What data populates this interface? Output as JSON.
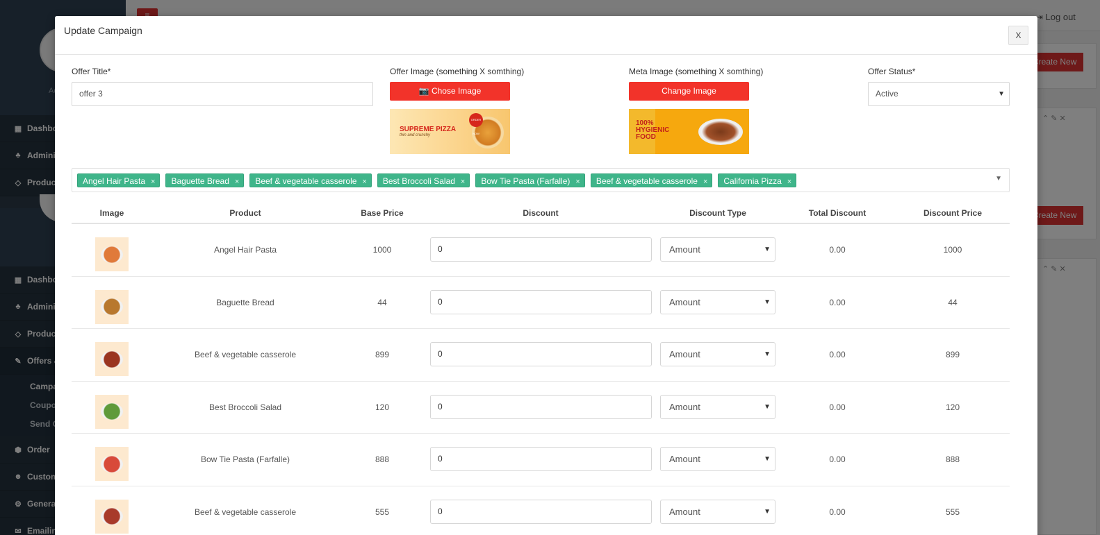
{
  "app": {
    "logout": "Log out",
    "create_new": "Create New",
    "sidebar": {
      "avatar_caption": "Ad",
      "menu_top": [
        {
          "label": "Dashbo",
          "icon": "dashboard-icon"
        },
        {
          "label": "Adminis",
          "icon": "sitemap-icon"
        },
        {
          "label": "Product",
          "icon": "diamond-icon"
        }
      ],
      "menu_bottom": [
        {
          "label": "Dashbo",
          "icon": "dashboard-icon"
        },
        {
          "label": "Adminis",
          "icon": "sitemap-icon"
        },
        {
          "label": "Product",
          "icon": "diamond-icon"
        },
        {
          "label": "Offers &",
          "icon": "fire-icon"
        }
      ],
      "offers_submenu": [
        "Campa",
        "Coupo",
        "Send C"
      ],
      "menu_after": [
        {
          "label": "Order",
          "icon": "cube-icon"
        },
        {
          "label": "Custom",
          "icon": "users-icon"
        },
        {
          "label": "General",
          "icon": "gear-icon"
        },
        {
          "label": "Emailin",
          "icon": "mail-icon"
        }
      ]
    }
  },
  "modal": {
    "title": "Update Campaign",
    "close_label": "X",
    "offer_title": {
      "label": "Offer Title*",
      "value": "offer 3"
    },
    "offer_image": {
      "label": "Offer Image (something X somthing)",
      "button": "Chose Image",
      "banner_title": "SUPREME PIZZA",
      "banner_sub": "thin and crunchy",
      "banner_badge": "ORDER NOW"
    },
    "meta_image": {
      "label": "Meta Image (something X somthing)",
      "button": "Change Image",
      "banner_line1": "100%",
      "banner_line2": "HYGIENIC",
      "banner_line3": "FOOD"
    },
    "offer_status": {
      "label": "Offer Status*",
      "value": "Active"
    },
    "selected_products": [
      "Angel Hair Pasta",
      "Baguette Bread",
      "Beef & vegetable casserole",
      "Best Broccoli Salad",
      "Bow Tie Pasta (Farfalle)",
      "Beef & vegetable casserole",
      "California Pizza"
    ],
    "table": {
      "headers": [
        "Image",
        "Product",
        "Base Price",
        "Discount",
        "Discount Type",
        "Total Discount",
        "Discount Price"
      ],
      "rows": [
        {
          "product": "Angel Hair Pasta",
          "base_price": "1000",
          "discount": "0",
          "discount_type": "Amount",
          "total_discount": "0.00",
          "discount_price": "1000",
          "dish_color": "#e07a3a"
        },
        {
          "product": "Baguette Bread",
          "base_price": "44",
          "discount": "0",
          "discount_type": "Amount",
          "total_discount": "0.00",
          "discount_price": "44",
          "dish_color": "#b8782e"
        },
        {
          "product": "Beef & vegetable casserole",
          "base_price": "899",
          "discount": "0",
          "discount_type": "Amount",
          "total_discount": "0.00",
          "discount_price": "899",
          "dish_color": "#9a3520"
        },
        {
          "product": "Best Broccoli Salad",
          "base_price": "120",
          "discount": "0",
          "discount_type": "Amount",
          "total_discount": "0.00",
          "discount_price": "120",
          "dish_color": "#5f9a3a"
        },
        {
          "product": "Bow Tie Pasta (Farfalle)",
          "base_price": "888",
          "discount": "0",
          "discount_type": "Amount",
          "total_discount": "0.00",
          "discount_price": "888",
          "dish_color": "#d84a3a"
        },
        {
          "product": "Beef & vegetable casserole",
          "base_price": "555",
          "discount": "0",
          "discount_type": "Amount",
          "total_discount": "0.00",
          "discount_price": "555",
          "dish_color": "#a83a2a"
        }
      ]
    }
  }
}
